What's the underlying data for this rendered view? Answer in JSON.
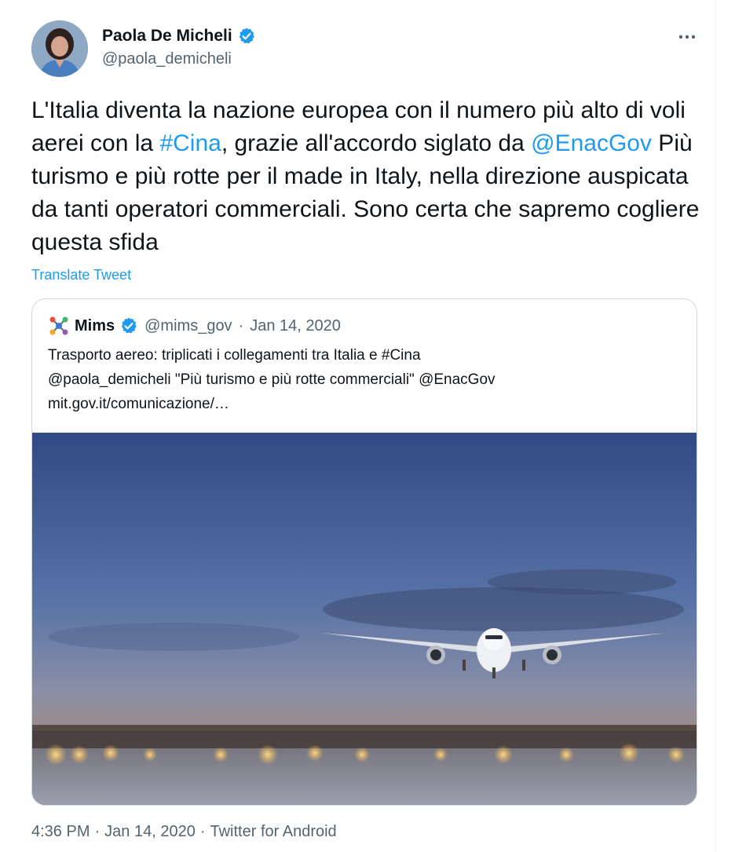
{
  "author": {
    "display_name": "Paola De Micheli",
    "handle": "@paola_demicheli"
  },
  "tweet": {
    "text_parts": [
      "L'Italia diventa la nazione europea con il numero più alto di voli aerei con la ",
      "#Cina",
      ", grazie all'accordo siglato da ",
      "@EnacGov",
      " Più turismo e più rotte per il made in Italy, nella direzione auspicata da tanti operatori commerciali. Sono certa che sapremo cogliere questa sfida"
    ],
    "translate_label": "Translate Tweet"
  },
  "quoted": {
    "name": "Mims",
    "handle": "@mims_gov",
    "separator": "·",
    "date": "Jan 14, 2020",
    "lines": [
      "Trasporto aereo: triplicati i collegamenti tra Italia e #Cina",
      "@paola_demicheli \"Più turismo e più rotte commerciali\" @EnacGov",
      "mit.gov.it/comunicazione/…"
    ]
  },
  "footer": {
    "time": "4:36 PM",
    "sep1": "·",
    "date": "Jan 14, 2020",
    "sep2": "·",
    "source": "Twitter for Android"
  },
  "colors": {
    "link": "#1d9bf0",
    "text": "#0f1419",
    "muted": "#536471",
    "border": "#cfd9de"
  },
  "icons": {
    "more": "more-horizontal-icon",
    "verified": "verified-badge-icon",
    "quoted_logo": "mims-logo-icon"
  }
}
